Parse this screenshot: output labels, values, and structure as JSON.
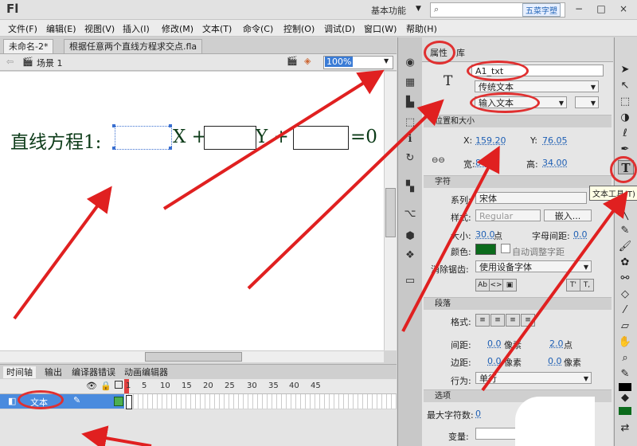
{
  "app": {
    "logo": "Fl",
    "workspace": "基本功能",
    "watermark": "五菜字塑"
  },
  "window_controls": [
    "−",
    "□",
    "×"
  ],
  "menu": [
    "文件(F)",
    "编辑(E)",
    "视图(V)",
    "插入(I)",
    "修改(M)",
    "文本(T)",
    "命令(C)",
    "控制(O)",
    "调试(D)",
    "窗口(W)",
    "帮助(H)"
  ],
  "doc_tabs": [
    "未命名-2*",
    "根据任意两个直线方程求交点.fla"
  ],
  "editbar": {
    "scene": "场景 1",
    "zoom": "100%"
  },
  "stage": {
    "equation_label": "直线方程1:",
    "x_term": "X +",
    "y_term": "Y +",
    "eq_term": "=0"
  },
  "timeline": {
    "tabs": [
      "时间轴",
      "输出",
      "编译器错误",
      "动画编辑器"
    ],
    "frame_numbers": [
      "1",
      "5",
      "10",
      "15",
      "20",
      "25",
      "30",
      "35",
      "40",
      "45"
    ],
    "layer_name": "文本"
  },
  "properties": {
    "tabs": [
      "属性",
      "库"
    ],
    "instance_name": "A1_txt",
    "text_engine": "传统文本",
    "text_type": "输入文本",
    "sections": {
      "position": "位置和大小",
      "character": "字符",
      "paragraph": "段落",
      "options": "选项"
    },
    "x_label": "X:",
    "x_value": "159.20",
    "y_label": "Y:",
    "y_value": "76.05",
    "w_label": "宽:",
    "w_value": "80.",
    "h_label": "高:",
    "h_value": "34.00",
    "family_label": "系列:",
    "family_value": "宋体",
    "style_label": "样式:",
    "style_value": "Regular",
    "embed_button": "嵌入...",
    "size_label": "大小:",
    "size_value": "30.0",
    "size_unit": "点",
    "spacing_label": "字母间距:",
    "spacing_value": "0.0",
    "color_label": "颜色:",
    "color_hex": "#0b6b1c",
    "autokern_label": "自动调整字距",
    "antialias_label": "消除锯齿:",
    "antialias_value": "使用设备字体",
    "format_label": "格式:",
    "gap_label": "间距:",
    "gap_value1": "0.0",
    "gap_unit1": "像素",
    "gap_value2": "2.0",
    "gap_unit2": "点",
    "margin_label": "边距:",
    "margin_value1": "0.0",
    "margin_unit1": "像素",
    "margin_value2": "0.0",
    "margin_unit2": "像素",
    "behavior_label": "行为:",
    "behavior_value": "单行",
    "maxchars_label": "最大字符数:",
    "maxchars_value": "0",
    "variable_label": "变量:"
  },
  "tooltip": "文本工具(T)"
}
